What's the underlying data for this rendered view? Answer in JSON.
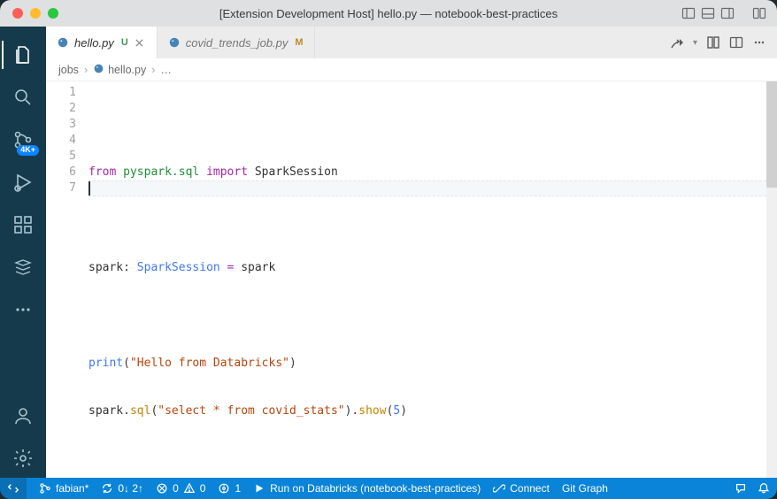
{
  "title": "[Extension Development Host] hello.py — notebook-best-practices",
  "tabs": [
    {
      "label": "hello.py",
      "status": "U",
      "active": true
    },
    {
      "label": "covid_trends_job.py",
      "status": "M",
      "active": false
    }
  ],
  "breadcrumb": {
    "segment1": "jobs",
    "segment2": "hello.py",
    "segment3": "…"
  },
  "activity": {
    "scm_badge": "4K+"
  },
  "code": {
    "lines": [
      {
        "n": "1"
      },
      {
        "n": "2"
      },
      {
        "n": "3"
      },
      {
        "n": "4"
      },
      {
        "n": "5"
      },
      {
        "n": "6"
      },
      {
        "n": "7"
      }
    ],
    "l1": {
      "kw_from": "from",
      "mod": "pyspark.sql",
      "kw_import": "import",
      "name": "SparkSession"
    },
    "l3": {
      "var": "spark",
      "type": "SparkSession",
      "eq": "=",
      "rhs": "spark"
    },
    "l5": {
      "fn": "print",
      "str": "\"Hello from Databricks\""
    },
    "l6": {
      "obj": "spark",
      "m1": "sql",
      "arg": "\"select * from covid_stats\"",
      "m2": "show",
      "num": "5"
    }
  },
  "status": {
    "branch": "fabian*",
    "sync": "0↓ 2↑",
    "errors": "0",
    "warnings": "0",
    "ports": "1",
    "run": "Run on Databricks (notebook-best-practices)",
    "connect": "Connect",
    "gitgraph": "Git Graph"
  }
}
